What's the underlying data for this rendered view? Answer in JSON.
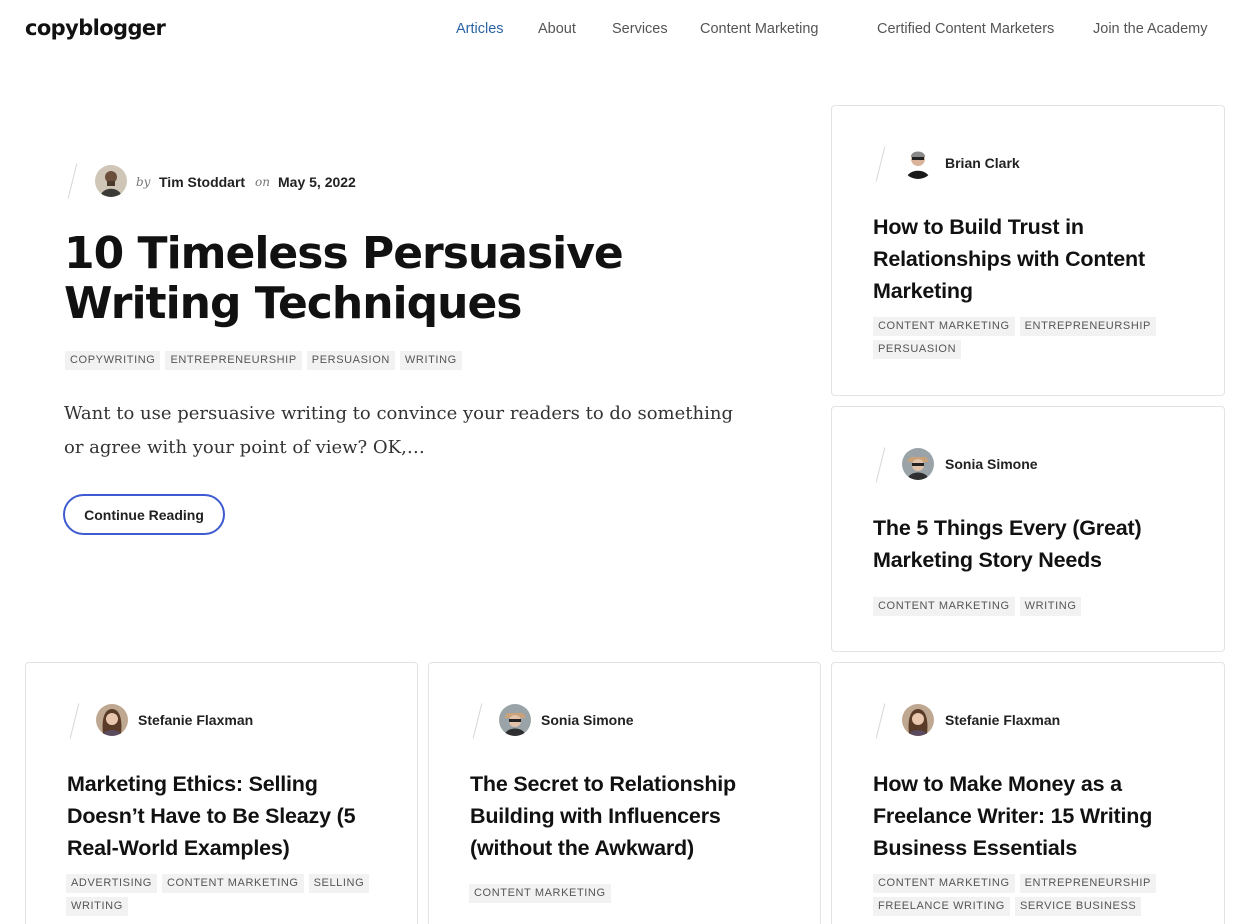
{
  "header": {
    "logo": "copyblogger",
    "nav": [
      {
        "label": "Articles",
        "active": true
      },
      {
        "label": "About",
        "active": false
      },
      {
        "label": "Services",
        "active": false
      },
      {
        "label": "Content Marketing",
        "active": false
      },
      {
        "label": "Certified Content Marketers",
        "active": false
      },
      {
        "label": "Join the Academy",
        "active": false
      }
    ]
  },
  "featured": {
    "by": "by",
    "author": "Tim Stoddart",
    "on": "on",
    "date": "May 5, 2022",
    "title": "10 Timeless Persuasive Writing Techniques",
    "tags": [
      "COPYWRITING",
      "ENTREPRENEURSHIP",
      "PERSUASION",
      "WRITING"
    ],
    "excerpt": "Want to use persuasive writing to convince your readers to do something or agree with your point of view? OK,…",
    "button": "Continue Reading"
  },
  "cards": [
    {
      "author": "Brian Clark",
      "title": "How to Build Trust in Relationships with Content Marketing",
      "tags": [
        "CONTENT MARKETING",
        "ENTREPRENEURSHIP",
        "PERSUASION"
      ]
    },
    {
      "author": "Sonia Simone",
      "title": "The 5 Things Every (Great) Marketing Story Needs",
      "tags": [
        "CONTENT MARKETING",
        "WRITING"
      ]
    },
    {
      "author": "Stefanie Flaxman",
      "title": "Marketing Ethics: Selling Doesn’t Have to Be Sleazy (5 Real-World Examples)",
      "tags": [
        "ADVERTISING",
        "CONTENT MARKETING",
        "SELLING",
        "WRITING"
      ]
    },
    {
      "author": "Sonia Simone",
      "title": "The Secret to Relationship Building with Influencers (without the Awkward)",
      "tags": [
        "CONTENT MARKETING"
      ]
    },
    {
      "author": "Stefanie Flaxman",
      "title": "How to Make Money as a Freelance Writer: 15 Writing Business Essentials",
      "tags": [
        "CONTENT MARKETING",
        "ENTREPRENEURSHIP",
        "FREELANCE WRITING",
        "SERVICE BUSINESS"
      ]
    }
  ],
  "colors": {
    "nav_active": "#2b64a6",
    "button_border": "#3f5bd1",
    "tag_bg": "#f2f2f2"
  }
}
